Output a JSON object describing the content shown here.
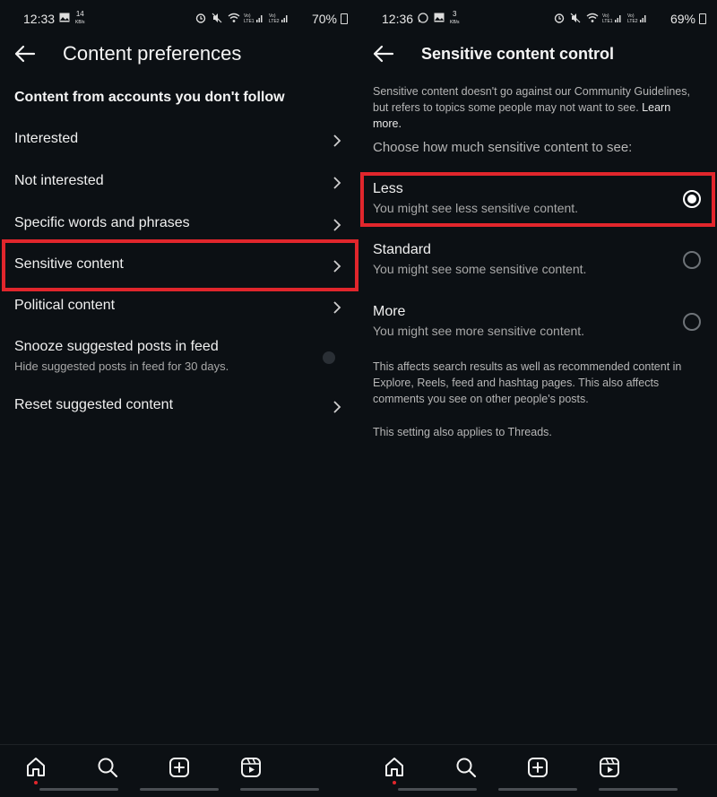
{
  "left": {
    "status": {
      "time": "12:33",
      "kbs": "14",
      "kbs_unit": "KB/s",
      "battery": "70%"
    },
    "title": "Content preferences",
    "section": "Content from accounts you don't follow",
    "items": [
      {
        "label": "Interested"
      },
      {
        "label": "Not interested"
      },
      {
        "label": "Specific words and phrases"
      },
      {
        "label": "Sensitive content"
      },
      {
        "label": "Political content"
      },
      {
        "label": "Snooze suggested posts in feed",
        "sub": "Hide suggested posts in feed for 30 days."
      },
      {
        "label": "Reset suggested content"
      }
    ]
  },
  "right": {
    "status": {
      "time": "12:36",
      "kbs": "3",
      "kbs_unit": "KB/s",
      "battery": "69%"
    },
    "title": "Sensitive content control",
    "desc": "Sensitive content doesn't go against our Community Guidelines, but refers to topics some people may not want to see.",
    "learn_more": "Learn more.",
    "choose": "Choose how much sensitive content to see:",
    "options": [
      {
        "label": "Less",
        "sub": "You might see less sensitive content.",
        "selected": true
      },
      {
        "label": "Standard",
        "sub": "You might see some sensitive content.",
        "selected": false
      },
      {
        "label": "More",
        "sub": "You might see more sensitive content.",
        "selected": false
      }
    ],
    "note1": "This affects search results as well as recommended content in Explore, Reels, feed and hashtag pages. This also affects comments you see on other people's posts.",
    "note2": "This setting also applies to Threads."
  },
  "colors": {
    "highlight": "#e1262c",
    "background": "#0c1014",
    "notification_dot": "#e1262c"
  },
  "nav_icons": [
    "home-icon",
    "search-icon",
    "create-icon",
    "reels-icon"
  ]
}
